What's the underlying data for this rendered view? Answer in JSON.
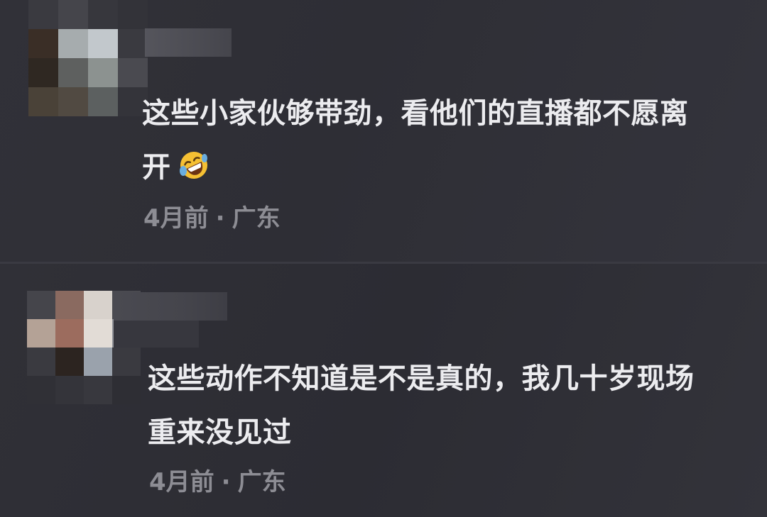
{
  "comments": [
    {
      "text_line1": "这些小家伙够带劲，看他们的直播都不愿离",
      "text_line2": "开",
      "emoji": "rolling-on-floor-laughing",
      "time": "4月前",
      "separator": "·",
      "location": "广东"
    },
    {
      "text_line1": "这些动作不知道是不是真的，我几十岁现场",
      "text_line2": "重来没见过",
      "time": "4月前",
      "separator": "·",
      "location": "广东"
    }
  ],
  "colors": {
    "background": "#2b2b32",
    "comment_text": "#ececef",
    "meta_text": "#8d8d94",
    "emoji_face": "#f5c033",
    "emoji_tear": "#6aaee0"
  }
}
